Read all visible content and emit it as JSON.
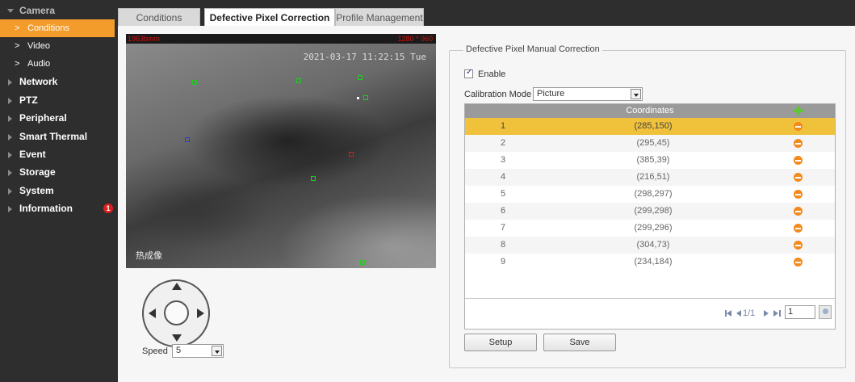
{
  "sidebar": {
    "items": [
      {
        "label": "Camera",
        "open": true
      },
      {
        "label": "Network"
      },
      {
        "label": "PTZ"
      },
      {
        "label": "Peripheral"
      },
      {
        "label": "Smart Thermal"
      },
      {
        "label": "Event"
      },
      {
        "label": "Storage"
      },
      {
        "label": "System"
      },
      {
        "label": "Information",
        "badge": "1"
      }
    ],
    "sub_items": [
      {
        "chevron": ">",
        "label": "Conditions",
        "active": true
      },
      {
        "chevron": ">",
        "label": "Video"
      },
      {
        "chevron": ">",
        "label": "Audio"
      }
    ],
    "badge_color": "#e01e1e",
    "active_color": "#f39c2c"
  },
  "tabs": [
    {
      "label": "Conditions",
      "active": false
    },
    {
      "label": "Defective Pixel Correction",
      "active": true
    },
    {
      "label": "Profile Management",
      "active": false
    }
  ],
  "video": {
    "overlay_top_left": "1963bmm",
    "overlay_top_right": "1280 * 960",
    "timestamp": "2021-03-17 11:22:15 Tue",
    "channel_label": "热成像"
  },
  "ptz": {
    "speed_label": "Speed",
    "speed_value": "5"
  },
  "correction": {
    "legend": "Defective Pixel Manual Correction",
    "enable_label": "Enable",
    "enable_checked": true,
    "calibration_mode_label": "Calibration Mode",
    "calibration_mode_value": "Picture",
    "table": {
      "header_coordinates": "Coordinates",
      "rows": [
        {
          "num": "1",
          "coord": "(285,150)",
          "selected": true
        },
        {
          "num": "2",
          "coord": "(295,45)"
        },
        {
          "num": "3",
          "coord": "(385,39)"
        },
        {
          "num": "4",
          "coord": "(216,51)"
        },
        {
          "num": "5",
          "coord": "(298,297)"
        },
        {
          "num": "6",
          "coord": "(299,298)"
        },
        {
          "num": "7",
          "coord": "(299,296)"
        },
        {
          "num": "8",
          "coord": "(304,73)"
        },
        {
          "num": "9",
          "coord": "(234,184)"
        }
      ]
    },
    "pager": {
      "page_info": "1/1",
      "page_input": "1"
    },
    "setup_label": "Setup",
    "save_label": "Save",
    "selected_row_color": "#f0c23b",
    "add_icon_color": "#5fc43a",
    "delete_icon_color": "#f28a1c"
  }
}
